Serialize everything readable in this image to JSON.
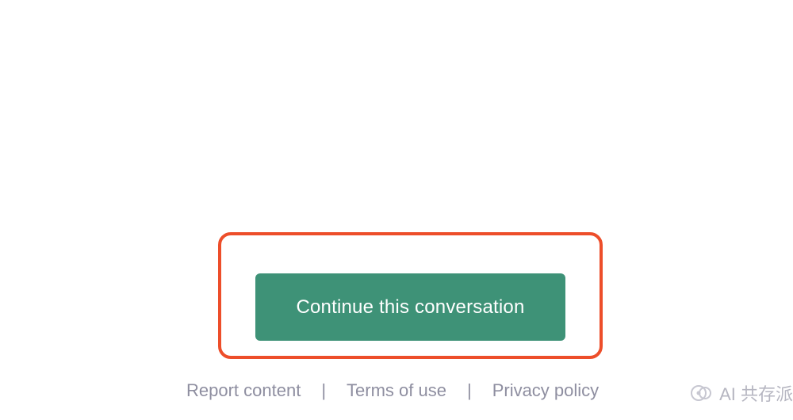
{
  "main": {
    "continue_label": "Continue this conversation"
  },
  "footer": {
    "report_label": "Report content",
    "terms_label": "Terms of use",
    "privacy_label": "Privacy policy"
  },
  "watermark": {
    "text": "AI 共存派"
  },
  "colors": {
    "highlight_border": "#ed4e2a",
    "button_bg": "#3e9277",
    "link_color": "#8e8ea0"
  }
}
